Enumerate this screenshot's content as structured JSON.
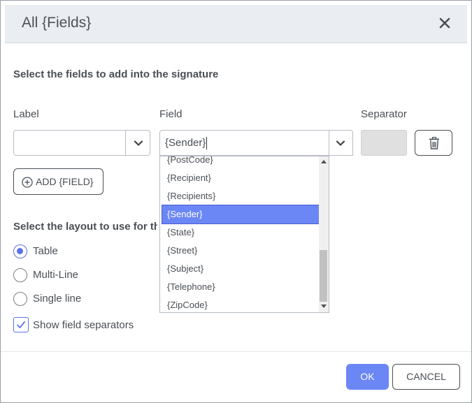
{
  "dialog": {
    "title": "All {Fields}",
    "instruction": "Select the fields to add into the signature"
  },
  "columns": {
    "label": "Label",
    "field": "Field",
    "separator": "Separator"
  },
  "row": {
    "label_value": "",
    "field_value": "{Sender}",
    "separator_value": ""
  },
  "add_field_label": "ADD {FIELD}",
  "dropdown": {
    "items": [
      "{PostCode}",
      "{Recipient}",
      "{Recipients}",
      "{Sender}",
      "{State}",
      "{Street}",
      "{Subject}",
      "{Telephone}",
      "{ZipCode}"
    ],
    "selected": "{Sender}"
  },
  "layout": {
    "heading": "Select the layout to use for the fields",
    "options": [
      {
        "label": "Table",
        "checked": true
      },
      {
        "label": "Multi-Line",
        "checked": false
      },
      {
        "label": "Single line",
        "checked": false
      }
    ],
    "show_separators_label": "Show field separators",
    "show_separators_checked": true
  },
  "footer": {
    "ok": "OK",
    "cancel": "CANCEL"
  },
  "colors": {
    "accent": "#6b86f5",
    "header_bg": "#eaedf1",
    "text": "#4a4f55"
  }
}
